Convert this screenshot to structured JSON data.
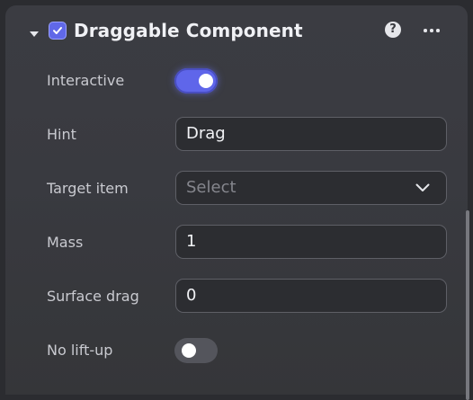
{
  "component": {
    "title": "Draggable Component",
    "enabled": true,
    "help_icon": "question-circle-icon",
    "help_glyph": "?",
    "more_icon": "ellipsis-icon"
  },
  "properties": {
    "interactive": {
      "label": "Interactive",
      "value": true
    },
    "hint": {
      "label": "Hint",
      "value": "Drag"
    },
    "target_item": {
      "label": "Target item",
      "value": "Select",
      "is_placeholder": true
    },
    "mass": {
      "label": "Mass",
      "value": "1"
    },
    "surface_drag": {
      "label": "Surface drag",
      "value": "0"
    },
    "no_lift_up": {
      "label": "No lift-up",
      "value": false
    }
  },
  "colors": {
    "accent": "#5f66ea",
    "panel": "#3a3b41",
    "field_border": "#5e5f66"
  }
}
